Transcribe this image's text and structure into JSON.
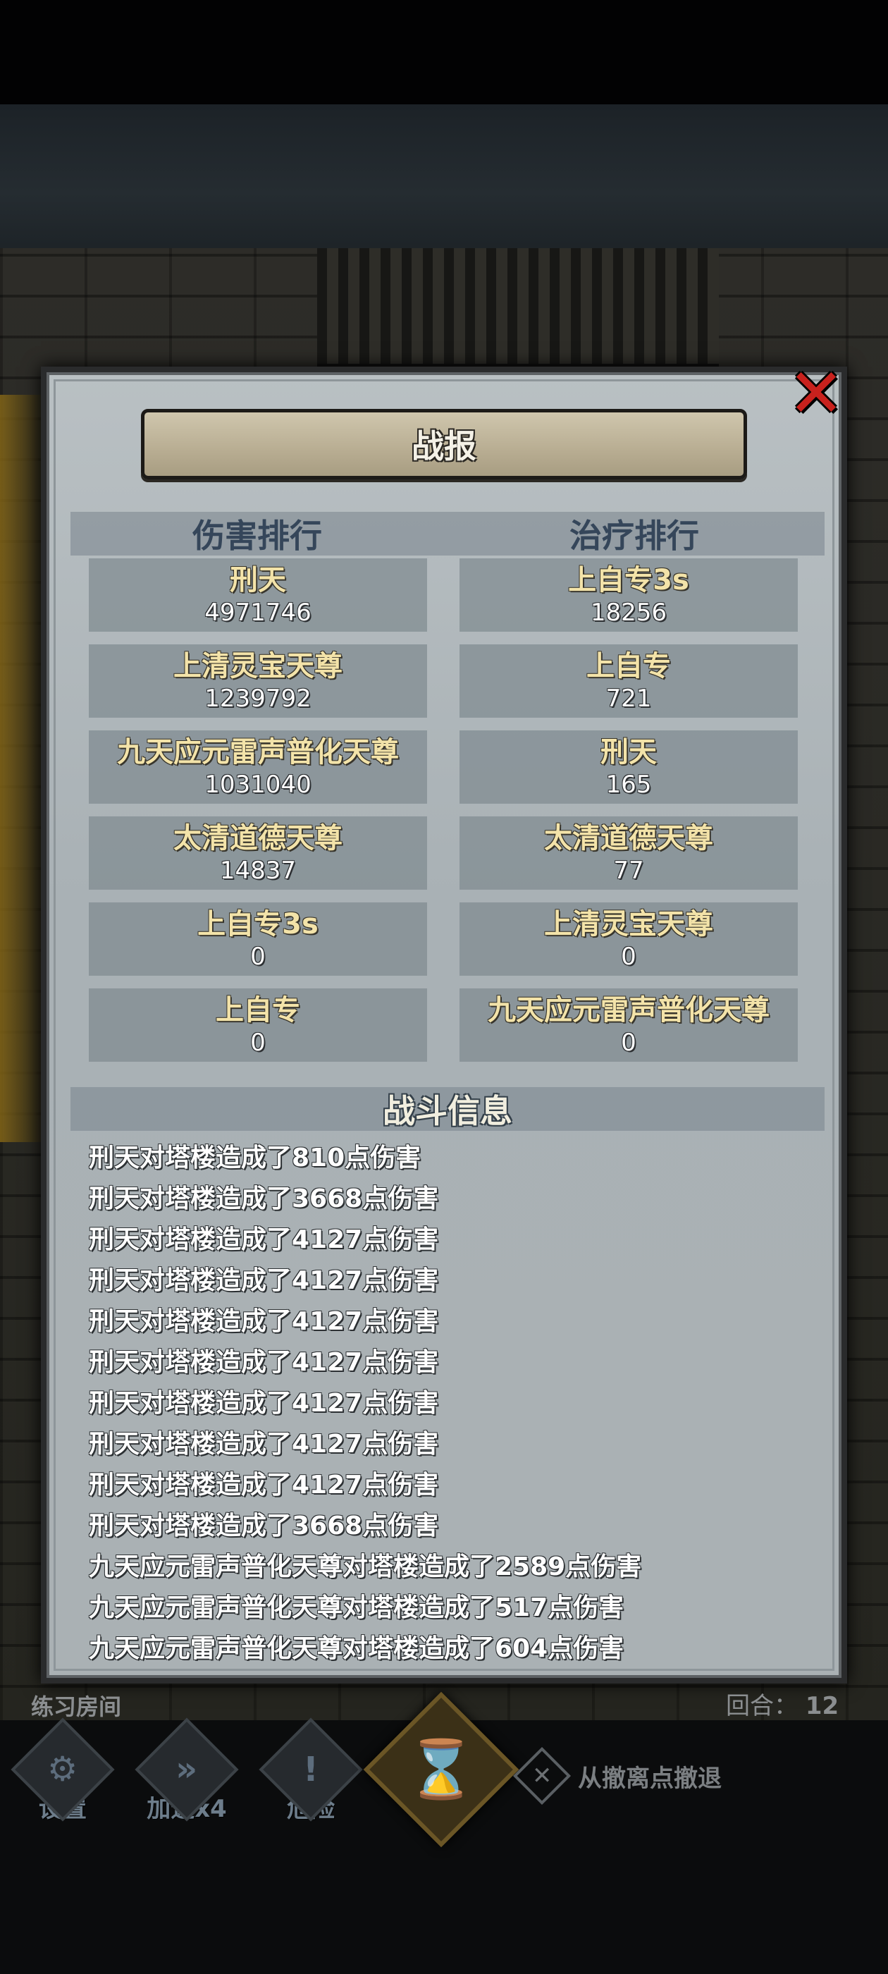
{
  "title": "战报",
  "headers": {
    "damage": "伤害排行",
    "healing": "治疗排行",
    "battle_info": "战斗信息"
  },
  "damage_ranking": [
    {
      "name": "刑天",
      "value": "4971746"
    },
    {
      "name": "上清灵宝天尊",
      "value": "1239792"
    },
    {
      "name": "九天应元雷声普化天尊",
      "value": "1031040"
    },
    {
      "name": "太清道德天尊",
      "value": "14837"
    },
    {
      "name": "上自专3s",
      "value": "0"
    },
    {
      "name": "上自专",
      "value": "0"
    }
  ],
  "healing_ranking": [
    {
      "name": "上自专3s",
      "value": "18256"
    },
    {
      "name": "上自专",
      "value": "721"
    },
    {
      "name": "刑天",
      "value": "165"
    },
    {
      "name": "太清道德天尊",
      "value": "77"
    },
    {
      "name": "上清灵宝天尊",
      "value": "0"
    },
    {
      "name": "九天应元雷声普化天尊",
      "value": "0"
    }
  ],
  "battle_log": [
    "刑天对塔楼造成了810点伤害",
    "刑天对塔楼造成了3668点伤害",
    "刑天对塔楼造成了4127点伤害",
    "刑天对塔楼造成了4127点伤害",
    "刑天对塔楼造成了4127点伤害",
    "刑天对塔楼造成了4127点伤害",
    "刑天对塔楼造成了4127点伤害",
    "刑天对塔楼造成了4127点伤害",
    "刑天对塔楼造成了4127点伤害",
    "刑天对塔楼造成了3668点伤害",
    "九天应元雷声普化天尊对塔楼造成了2589点伤害",
    "九天应元雷声普化天尊对塔楼造成了517点伤害",
    "九天应元雷声普化天尊对塔楼造成了604点伤害"
  ],
  "status": {
    "room": "练习房间",
    "round_label": "回合：",
    "round_value": "12"
  },
  "bottom_bar": {
    "settings": "设置",
    "speed": "加速x4",
    "danger": "危险",
    "retreat": "从撤离点撤退"
  },
  "icons": {
    "close": "close-x-icon",
    "settings": "gear-icon",
    "speed": "fast-forward-icon",
    "danger": "exclamation-icon",
    "center": "hourglass-icon",
    "retreat": "crossed-tools-icon"
  },
  "colors": {
    "name_gold": "#f3e3a9",
    "close_red": "#c8211d",
    "panel": "#aab1b4",
    "header_blue": "#35465a"
  }
}
